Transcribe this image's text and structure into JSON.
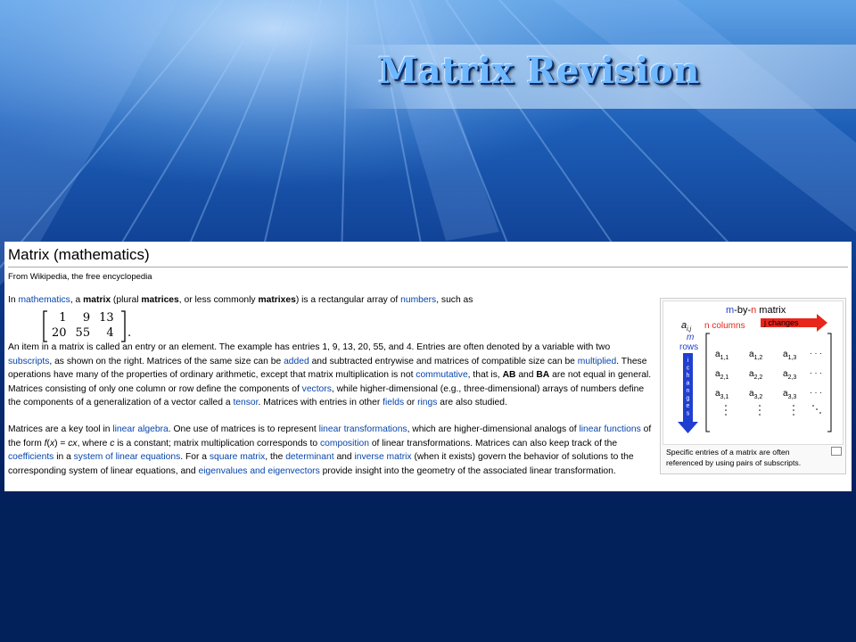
{
  "slide": {
    "title": "Matrix Revision"
  },
  "article": {
    "title": "Matrix (mathematics)",
    "from": "From Wikipedia, the free encyclopedia",
    "p1": {
      "t1": "In ",
      "l1": "mathematics",
      "t2": ", a ",
      "b1": "matrix",
      "t3": " (plural ",
      "b2": "matrices",
      "t4": ", or less commonly ",
      "b3": "matrixes",
      "t5": ") is a rectangular array of ",
      "l2": "numbers",
      "t6": ", such as"
    },
    "matrix": {
      "rows": [
        [
          "1",
          "9",
          "13"
        ],
        [
          "20",
          "55",
          "4"
        ]
      ],
      "suffix": "."
    },
    "p2": {
      "t1": "An item in a matrix is called an entry or an element. The example has entries 1, 9, 13, 20, 55, and 4. Entries are often denoted by a variable with two ",
      "l1": "subscripts",
      "t2": ", as shown on the right. Matrices of the same size can be ",
      "l2": "added",
      "t3": " and subtracted entrywise and matrices of compatible size can be ",
      "l3": "multiplied",
      "t4": ". These operations have many of the properties of ordinary arithmetic, except that matrix multiplication is not ",
      "l4": "commutative",
      "t5": ", that is, ",
      "b1": "AB",
      "t6": " and ",
      "b2": "BA",
      "t7": " are not equal in general. Matrices consisting of only one column or row define the components of ",
      "l5": "vectors",
      "t8": ", while higher-dimensional (e.g., three-dimensional) arrays of numbers define the components of a generalization of a vector called a ",
      "l6": "tensor",
      "t9": ". Matrices with entries in other ",
      "l7": "fields",
      "t10": " or ",
      "l8": "rings",
      "t11": " are also studied."
    },
    "p3": {
      "t1": "Matrices are a key tool in ",
      "l1": "linear algebra",
      "t2": ". One use of matrices is to represent ",
      "l2": "linear transformations",
      "t3": ", which are higher-dimensional analogs of ",
      "l3": "linear functions",
      "t4": " of the form ",
      "i1": "f",
      "t5": "(",
      "i2": "x",
      "t6": ") = ",
      "i3": "cx",
      "t7": ", where ",
      "i4": "c",
      "t8": " is a constant; matrix multiplication corresponds to ",
      "l4": "composition",
      "t9": " of linear transformations. Matrices can also keep track of the ",
      "l5": "coefficients",
      "t10": " in a ",
      "l6": "system of linear equations",
      "t11": ". For a ",
      "l7": "square matrix",
      "t12": ", the ",
      "l8": "determinant",
      "t13": " and ",
      "l9": "inverse matrix",
      "t14": " (when it exists) govern the behavior of solutions to the corresponding system of linear equations, and ",
      "l10": "eigenvalues and eigenvectors",
      "t15": " provide insight into the geometry of the associated linear transformation."
    },
    "figure": {
      "m": "m",
      "by": "-by-",
      "n": "n",
      "matrix_word": " matrix",
      "aij": "a",
      "aij_sub": "i,j",
      "n_columns": "n columns",
      "j_changes": "j changes",
      "m_rows_m": "m",
      "m_rows_rows": "rows",
      "i_changes": [
        "i",
        "c",
        "h",
        "a",
        "n",
        "g",
        "e",
        "s"
      ],
      "entries": [
        [
          "a",
          "1,1"
        ],
        [
          "a",
          "1,2"
        ],
        [
          "a",
          "1,3"
        ],
        [
          "a",
          "2,1"
        ],
        [
          "a",
          "2,2"
        ],
        [
          "a",
          "2,3"
        ],
        [
          "a",
          "3,1"
        ],
        [
          "a",
          "3,2"
        ],
        [
          "a",
          "3,3"
        ]
      ],
      "hdots": "· · ·",
      "caption": "Specific entries of a matrix are often referenced by using pairs of subscripts."
    },
    "colors": {
      "link": "#0645ad",
      "red": "#e8261b",
      "blue": "#1f3fd1"
    }
  }
}
